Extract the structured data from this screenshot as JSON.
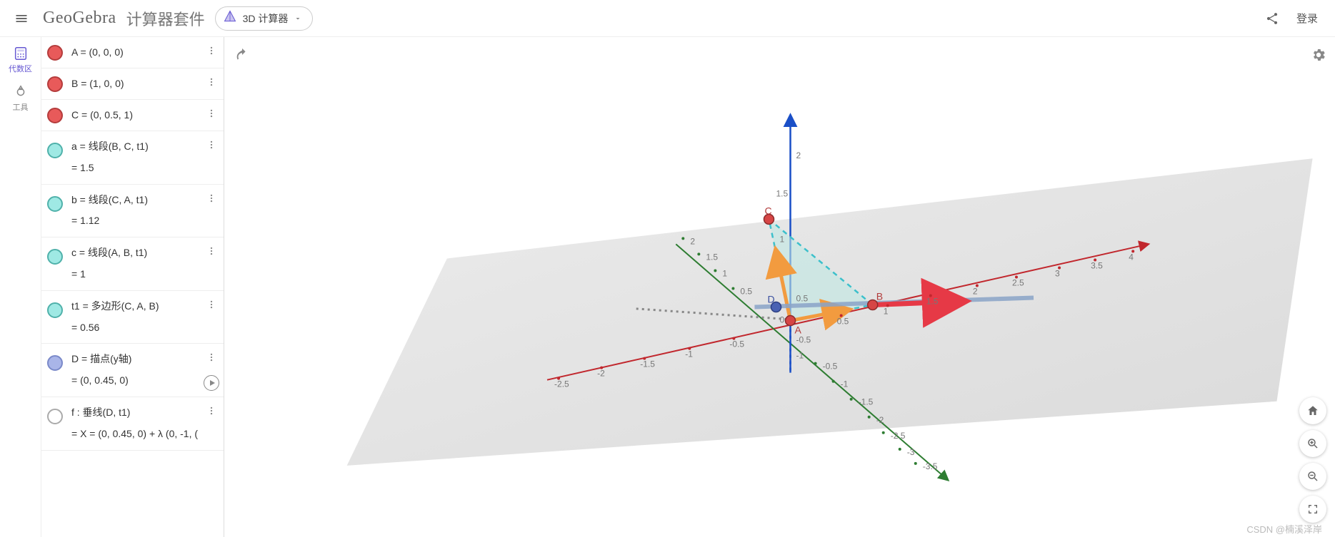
{
  "header": {
    "logo": "GeoGebra",
    "suite": "计算器套件",
    "calc_mode": "3D 计算器",
    "login": "登录"
  },
  "rail": {
    "algebra": "代数区",
    "tools": "工具"
  },
  "colors": {
    "point": "#e85a5a",
    "point_border": "#b43c3c",
    "segment": "#9fe9e4",
    "segment_border": "#4fb1aa",
    "pointD": "#a9b5e8",
    "pointD_border": "#7a89c9",
    "line": "#ffffff",
    "line_border": "#aaaaaa"
  },
  "algebra": [
    {
      "id": "A",
      "color": "point",
      "line1": "A = (0, 0, 0)"
    },
    {
      "id": "B",
      "color": "point",
      "line1": "B = (1, 0, 0)"
    },
    {
      "id": "C",
      "color": "point",
      "line1": "C = (0, 0.5, 1)"
    },
    {
      "id": "a",
      "color": "segment",
      "line1": "a = 线段(B, C, t1)",
      "line2": "= 1.5"
    },
    {
      "id": "b",
      "color": "segment",
      "line1": "b = 线段(C, A, t1)",
      "line2": "= 1.12"
    },
    {
      "id": "c",
      "color": "segment",
      "line1": "c = 线段(A, B, t1)",
      "line2": "= 1"
    },
    {
      "id": "t1",
      "color": "segment",
      "line1": "t1 = 多边形(C, A, B)",
      "line2": "= 0.56"
    },
    {
      "id": "D",
      "color": "pointD",
      "line1": "D = 描点(y轴)",
      "line2": "= (0, 0.45, 0)",
      "play": true
    },
    {
      "id": "f",
      "color": "line",
      "line1": "f : 垂线(D, t1)",
      "line2": "= X = (0, 0.45, 0) + λ (0, -1, ("
    }
  ],
  "canvas": {
    "labels": {
      "A": "A",
      "B": "B",
      "C": "C",
      "D": "D"
    },
    "x_ticks": [
      "-2.5",
      "-2",
      "-1.5",
      "-1",
      "-0.5",
      "0.5",
      "1",
      "1.5",
      "2",
      "2.5",
      "3",
      "3.5",
      "4"
    ],
    "y_ticks": [
      "-3.5",
      "-3",
      "-2.5",
      "-2",
      "-1.5",
      "-1",
      "-0.5",
      "0.5",
      "1",
      "1.5",
      "2"
    ],
    "z_ticks": [
      "-1",
      "-0.5",
      "0.5",
      "1",
      "1.5",
      "2"
    ],
    "origin": "0"
  },
  "watermark": "CSDN @楠溪泽岸",
  "chart_data": {
    "type": "3d-scene",
    "points": {
      "A": [
        0,
        0,
        0
      ],
      "B": [
        1,
        0,
        0
      ],
      "C": [
        0,
        0.5,
        1
      ],
      "D": [
        0,
        0.45,
        0
      ]
    },
    "segments": {
      "a": [
        "B",
        "C",
        1.5
      ],
      "b": [
        "C",
        "A",
        1.12
      ],
      "c": [
        "A",
        "B",
        1.0
      ]
    },
    "polygon": {
      "t1": [
        "C",
        "A",
        "B"
      ],
      "area": 0.56
    },
    "line_f": {
      "through": "D",
      "perp_to": "t1",
      "param": "X=(0,0.45,0)+λ(0,-1,?)"
    },
    "axes": {
      "x": [
        -2.5,
        4
      ],
      "y": [
        -3.5,
        2
      ],
      "z": [
        -1,
        2
      ]
    }
  }
}
